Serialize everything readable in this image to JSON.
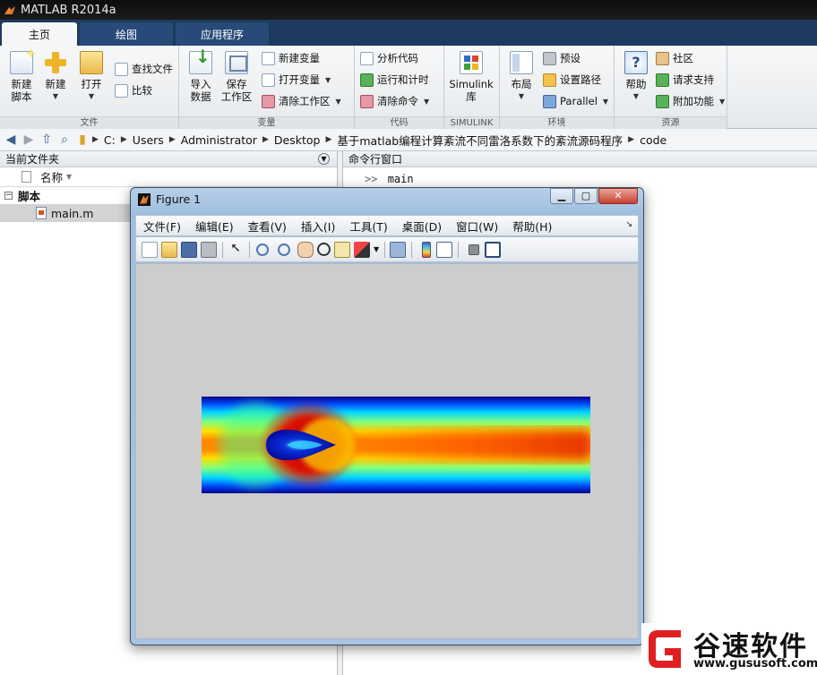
{
  "app": {
    "title": "MATLAB R2014a"
  },
  "tabs": [
    "主页",
    "绘图",
    "应用程序"
  ],
  "ribbon": {
    "file_group": {
      "label": "文件",
      "new_script": "新建\n脚本",
      "new": "新建",
      "open": "打开",
      "find_files": "查找文件",
      "compare": "比较"
    },
    "variable_group": {
      "label": "变量",
      "import_data": "导入\n数据",
      "save_workspace": "保存\n工作区",
      "new_variable": "新建变量",
      "open_variable": "打开变量",
      "clear_workspace": "清除工作区"
    },
    "code_group": {
      "label": "代码",
      "analyze_code": "分析代码",
      "run_and_time": "运行和计时",
      "clear_commands": "清除命令"
    },
    "simulink_group": {
      "label": "SIMULINK",
      "library": "Simulink\n库"
    },
    "environment_group": {
      "label": "环境",
      "layout": "布局",
      "preferences": "预设",
      "set_path": "设置路径",
      "parallel": "Parallel"
    },
    "resources_group": {
      "label": "资源",
      "help": "帮助",
      "community": "社区",
      "request_support": "请求支持",
      "add_ons": "附加功能"
    }
  },
  "address_bar": {
    "crumbs": [
      "C:",
      "Users",
      "Administrator",
      "Desktop",
      "基于matlab编程计算紊流不同雷洛系数下的紊流源码程序",
      "code"
    ]
  },
  "current_folder": {
    "title": "当前文件夹",
    "column_header": "名称",
    "section": "脚本",
    "files": [
      "main.m"
    ]
  },
  "command_window": {
    "title": "命令行窗口",
    "prompt_symbol": ">>",
    "command": "main"
  },
  "figure": {
    "title": "Figure 1",
    "menus": [
      "文件(F)",
      "编辑(E)",
      "查看(V)",
      "插入(I)",
      "工具(T)",
      "桌面(D)",
      "窗口(W)",
      "帮助(H)"
    ]
  },
  "watermark": {
    "title": "谷速软件",
    "url": "www.gususoft.com"
  },
  "colors": {
    "ribbon_tab_bg": "#1f3a5f",
    "canvas_bg": "#cdcdcd",
    "colormap": "jet"
  }
}
